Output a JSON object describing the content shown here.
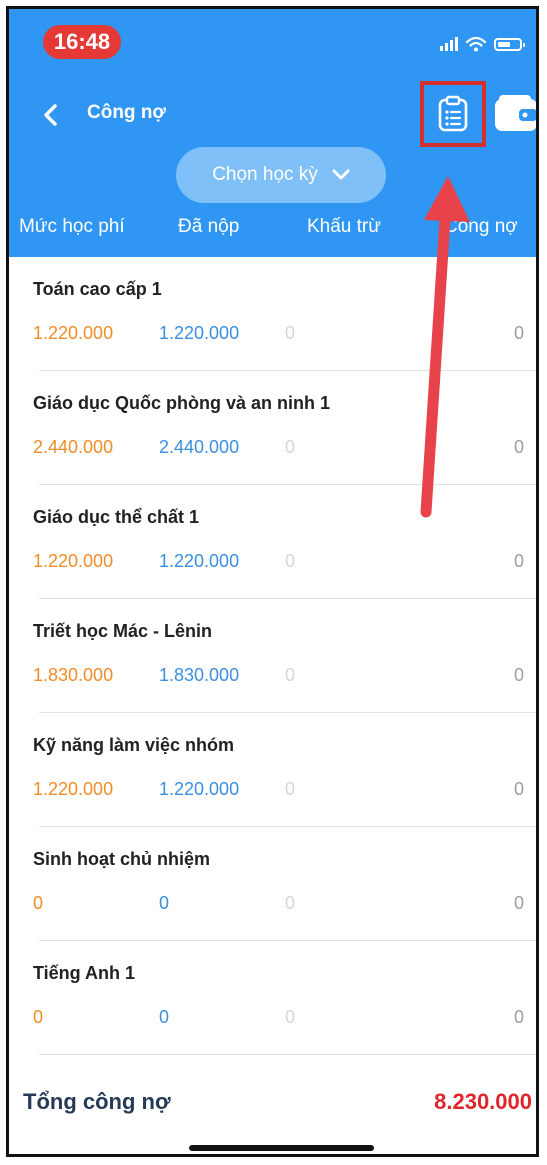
{
  "status": {
    "time": "16:48"
  },
  "header": {
    "title": "Công nợ",
    "semester_label": "Chọn học kỳ",
    "columns": [
      "Mức học phí",
      "Đã nộp",
      "Khấu trừ",
      "Công nợ"
    ]
  },
  "icons": {
    "back": "chevron-left-icon",
    "debt_list": "clipboard-list-icon",
    "wallet": "wallet-icon",
    "dropdown": "chevron-down-icon"
  },
  "colors": {
    "header_bg": "#2f96f3",
    "fee": "#f28c28",
    "paid": "#3b8fe0",
    "deduction": "#cfd8dc",
    "debt": "#9e9e9e",
    "total": "#e0252b",
    "highlight": "#d32f2f"
  },
  "items": [
    {
      "name": "Toán cao cấp 1",
      "fee": "1.220.000",
      "paid": "1.220.000",
      "deduction": "0",
      "debt": "0"
    },
    {
      "name": "Giáo dục Quốc phòng và an ninh 1",
      "fee": "2.440.000",
      "paid": "2.440.000",
      "deduction": "0",
      "debt": "0"
    },
    {
      "name": "Giáo dục thể chất 1",
      "fee": "1.220.000",
      "paid": "1.220.000",
      "deduction": "0",
      "debt": "0"
    },
    {
      "name": "Triết học Mác - Lênin",
      "fee": "1.830.000",
      "paid": "1.830.000",
      "deduction": "0",
      "debt": "0"
    },
    {
      "name": "Kỹ năng làm việc nhóm",
      "fee": "1.220.000",
      "paid": "1.220.000",
      "deduction": "0",
      "debt": "0"
    },
    {
      "name": "Sinh hoạt chủ nhiệm",
      "fee": "0",
      "paid": "0",
      "deduction": "0",
      "debt": "0"
    },
    {
      "name": "Tiếng Anh 1",
      "fee": "0",
      "paid": "0",
      "deduction": "0",
      "debt": "0"
    }
  ],
  "footer": {
    "total_label": "Tổng công nợ",
    "total_value": "8.230.000"
  }
}
